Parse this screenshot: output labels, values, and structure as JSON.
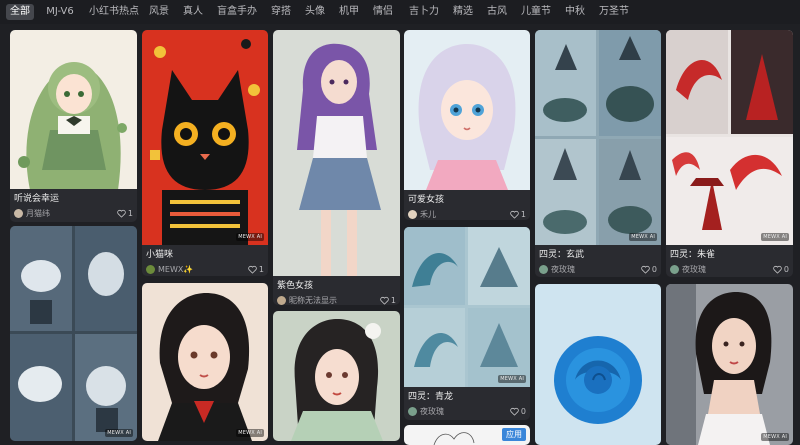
{
  "tabs": [
    {
      "label": "全部",
      "active": true
    },
    {
      "label": "MJ-V6"
    },
    {
      "label": "小红书热点"
    },
    {
      "label": "风景"
    },
    {
      "label": "真人"
    },
    {
      "label": "盲盒手办"
    },
    {
      "label": "穿搭"
    },
    {
      "label": "头像"
    },
    {
      "label": "机甲"
    },
    {
      "label": "情侣"
    },
    {
      "label": "吉卜力"
    },
    {
      "label": "精选"
    },
    {
      "label": "古风"
    },
    {
      "label": "儿童节"
    },
    {
      "label": "中秋"
    },
    {
      "label": "万圣节"
    }
  ],
  "watermark": "MEWX AI",
  "cards": {
    "c1": {
      "title": "听说会幸运",
      "author": "月猫纬",
      "likes": "1"
    },
    "c2": {
      "title": "小猫咪",
      "author": "MEWX✨",
      "likes": "1"
    },
    "c3": {
      "title": "紫色女孩",
      "author": "昵称无法显示",
      "likes": "1"
    },
    "c4": {
      "title": "可爱女孩",
      "author": "禾儿",
      "likes": "1"
    },
    "c5": {
      "title": "四灵：玄武",
      "author": "夜玫瑰",
      "likes": "0"
    },
    "c6": {
      "title": "四灵：朱雀",
      "author": "夜玫瑰",
      "likes": "0"
    },
    "c7": {
      "title": "四灵：青龙",
      "author": "夜玫瑰",
      "likes": "0"
    },
    "c8": {
      "badge": "应用"
    }
  },
  "colors": {
    "background": "#1f2024",
    "card": "#2a2b30",
    "active_tab": "#45474d",
    "cat_red": "#d8321f",
    "rose_blue": "#1f7fd0"
  }
}
